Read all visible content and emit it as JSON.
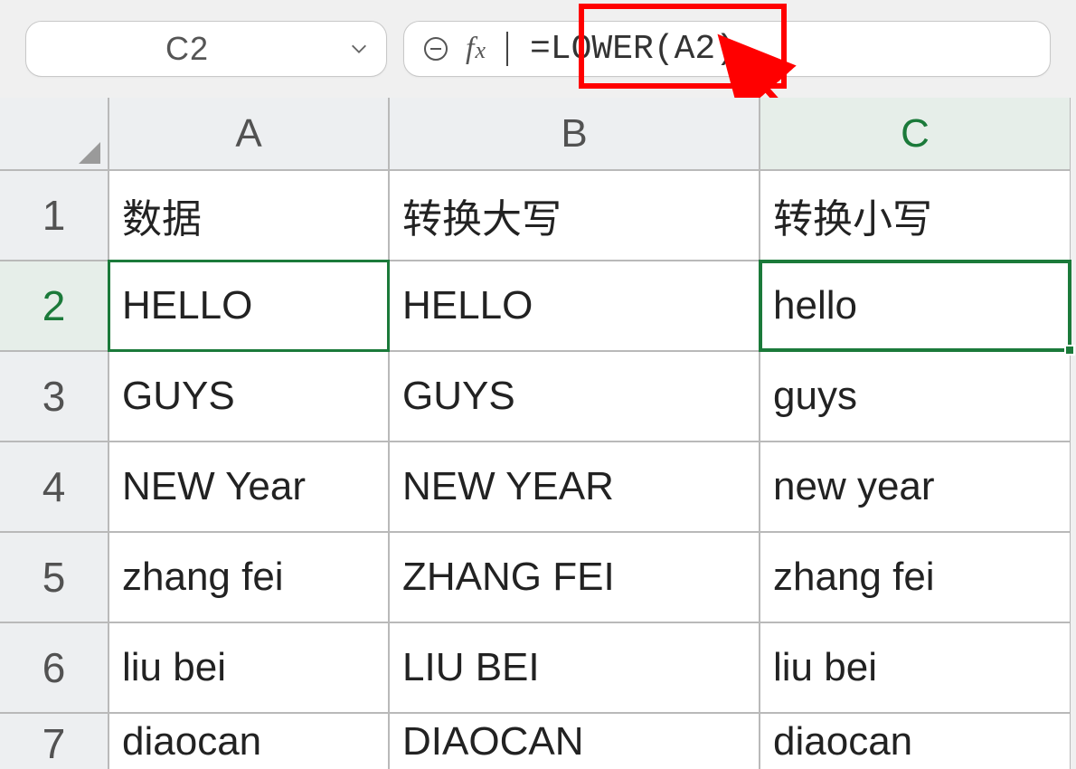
{
  "namebox": {
    "value": "C2"
  },
  "formula_bar": {
    "formula": "=LOWER(A2)"
  },
  "columns": [
    "A",
    "B",
    "C"
  ],
  "row_headers": [
    "1",
    "2",
    "3",
    "4",
    "5",
    "6",
    "7"
  ],
  "selected_cell": "C2",
  "source_ref_cell": "A2",
  "cells": {
    "A1": "数据",
    "B1": "转换大写",
    "C1": "转换小写",
    "A2": "HELLO",
    "B2": "HELLO",
    "C2": "hello",
    "A3": "GUYS",
    "B3": "GUYS",
    "C3": "guys",
    "A4": "NEW Year",
    "B4": "NEW YEAR",
    "C4": "new year",
    "A5": "zhang fei",
    "B5": "ZHANG FEI",
    "C5": "zhang fei",
    "A6": "liu bei",
    "B6": "LIU BEI",
    "C6": "liu bei",
    "A7": "diaocan",
    "B7": "DIAOCAN",
    "C7": "diaocan"
  },
  "annotation": {
    "highlight": "formula-box",
    "arrow_from": "C2",
    "arrow_to": "formula_bar"
  },
  "chart_data": {
    "type": "table",
    "columns": [
      "数据",
      "转换大写",
      "转换小写"
    ],
    "rows": [
      [
        "HELLO",
        "HELLO",
        "hello"
      ],
      [
        "GUYS",
        "GUYS",
        "guys"
      ],
      [
        "NEW Year",
        "NEW YEAR",
        "new year"
      ],
      [
        "zhang fei",
        "ZHANG FEI",
        "zhang fei"
      ],
      [
        "liu bei",
        "LIU BEI",
        "liu bei"
      ],
      [
        "diaocan",
        "DIAOCAN",
        "diaocan"
      ]
    ]
  }
}
